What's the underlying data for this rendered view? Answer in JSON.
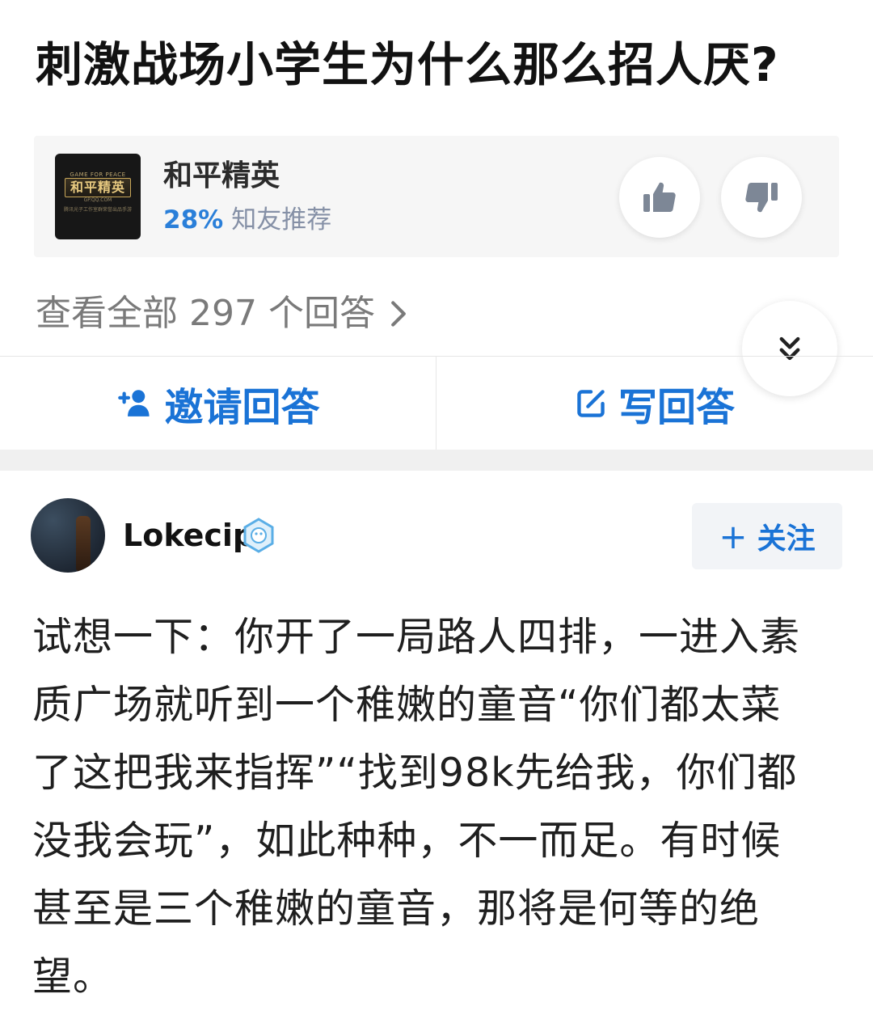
{
  "question": {
    "title": "刺激战场小学生为什么那么招人厌?"
  },
  "topic": {
    "name": "和平精英",
    "recommend_percent": "28%",
    "recommend_label": "知友推荐",
    "logo": {
      "top_text": "GAME FOR PEACE",
      "main_text": "和平精英",
      "url": "GP.QQ.COM",
      "sub_text": "腾讯光子工作室群荣誉出品手游"
    }
  },
  "view_all": {
    "label": "查看全部 297 个回答",
    "icon": "chevron-right-icon"
  },
  "actions": {
    "invite_label": "邀请回答",
    "write_label": "写回答",
    "accent_color": "#1a73d6"
  },
  "answer": {
    "author": "Lokecip",
    "follow_label": "关注",
    "follow_icon": "plus-icon",
    "lines": [
      "试想一下：你开了一局路人四排，一进入素",
      "质广场就听到一个稚嫩的童音“你们都太菜",
      "了这把我来指挥”“找到98k先给我，你们都",
      "没我会玩”，如此种种，不一而足。有时候",
      "甚至是三个稚嫩的童音，那将是何等的绝",
      "望。"
    ]
  }
}
